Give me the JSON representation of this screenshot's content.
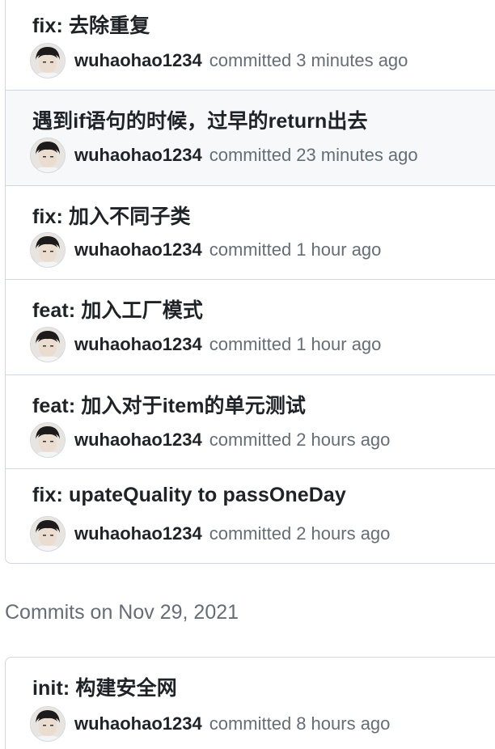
{
  "groups": [
    {
      "commits": [
        {
          "message": "fix: 去除重复",
          "author": "wuhaohao1234",
          "action": "committed",
          "time": "3 minutes ago"
        },
        {
          "message": "遇到if语句的时候，过早的return出去",
          "author": "wuhaohao1234",
          "action": "committed",
          "time": "23 minutes ago"
        },
        {
          "message": "fix: 加入不同子类",
          "author": "wuhaohao1234",
          "action": "committed",
          "time": "1 hour ago"
        },
        {
          "message": "feat: 加入工厂模式",
          "author": "wuhaohao1234",
          "action": "committed",
          "time": "1 hour ago"
        },
        {
          "message": "feat: 加入对于item的单元测试",
          "author": "wuhaohao1234",
          "action": "committed",
          "time": "2 hours ago"
        },
        {
          "message": "fix: upateQuality to passOneDay",
          "author": "wuhaohao1234",
          "action": "committed",
          "time": "2 hours ago"
        }
      ]
    },
    {
      "heading": "Commits on Nov 29, 2021",
      "commits": [
        {
          "message": "init: 构建安全网",
          "author": "wuhaohao1234",
          "action": "committed",
          "time": "8 hours ago"
        }
      ]
    }
  ],
  "colors": {
    "border": "#d0d7de",
    "highlight_row": "#f6f8fa",
    "text_primary": "#1f2328",
    "text_muted": "#656d76"
  },
  "icons": {
    "avatar": "user-avatar-icon"
  }
}
